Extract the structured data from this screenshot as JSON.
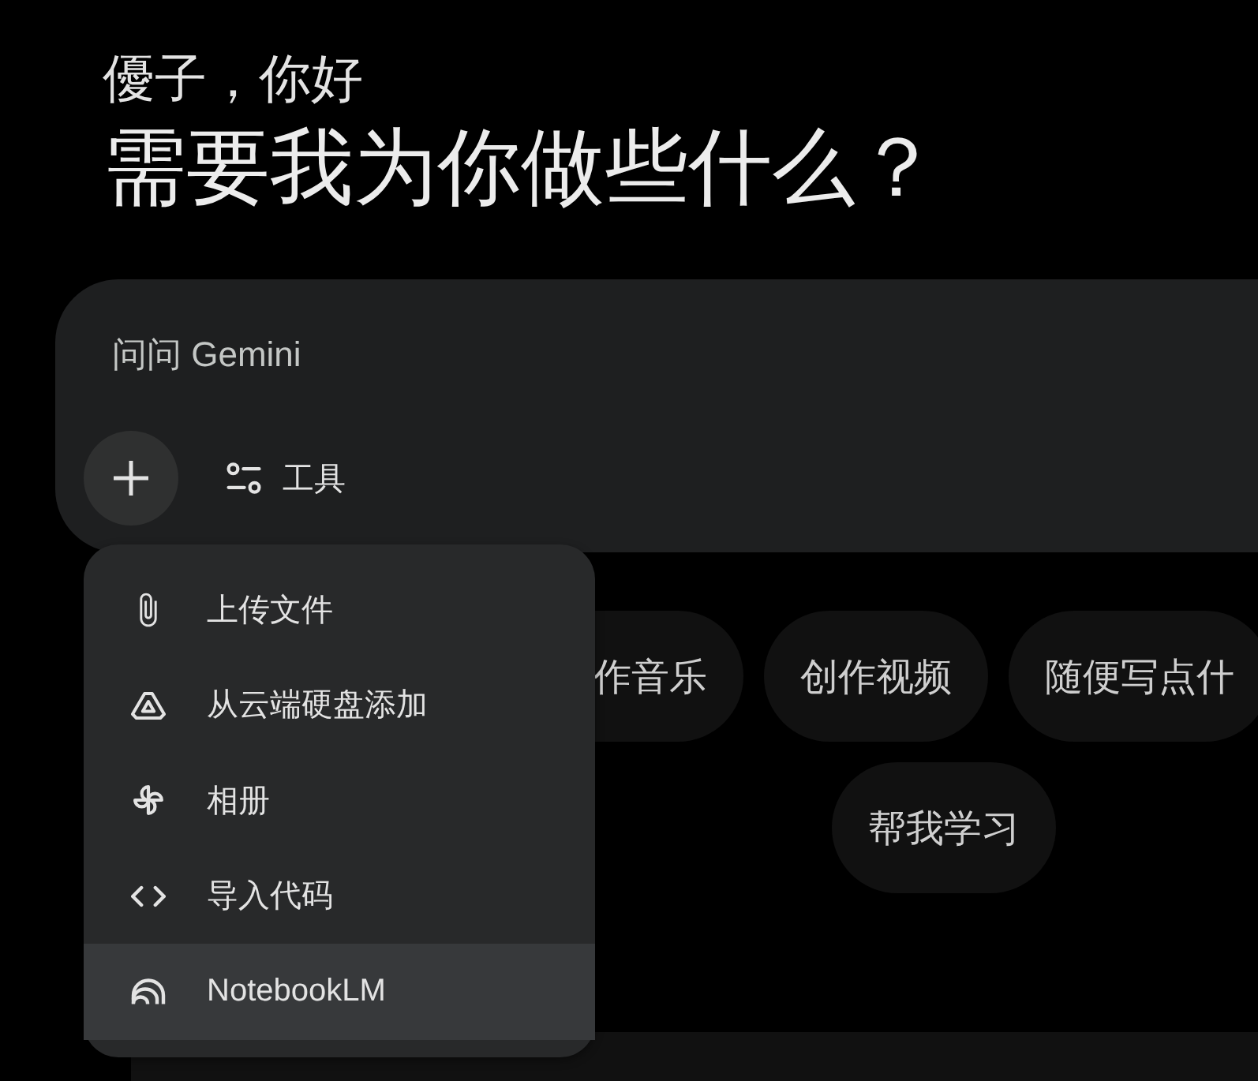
{
  "greeting": "優子，你好",
  "heading": "需要我为你做些什么？",
  "prompt": {
    "placeholder": "问问 Gemini",
    "tools_label": "工具"
  },
  "menu": {
    "items": [
      {
        "label": "上传文件",
        "highlighted": false
      },
      {
        "label": "从云端硬盘添加",
        "highlighted": false
      },
      {
        "label": "相册",
        "highlighted": false
      },
      {
        "label": "导入代码",
        "highlighted": false
      },
      {
        "label": "NotebookLM",
        "highlighted": true
      }
    ]
  },
  "suggestion_rows": [
    {
      "chips": [
        "作音乐",
        "创作视频",
        "随便写点什"
      ]
    },
    {
      "chips": [
        "帮我学习"
      ]
    }
  ]
}
